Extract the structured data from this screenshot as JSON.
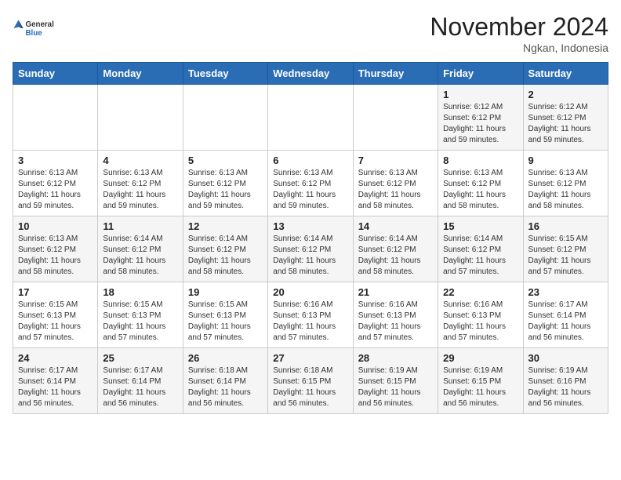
{
  "header": {
    "logo_general": "General",
    "logo_blue": "Blue",
    "month_title": "November 2024",
    "subtitle": "Ngkan, Indonesia"
  },
  "days_of_week": [
    "Sunday",
    "Monday",
    "Tuesday",
    "Wednesday",
    "Thursday",
    "Friday",
    "Saturday"
  ],
  "weeks": [
    [
      {
        "day": "",
        "info": ""
      },
      {
        "day": "",
        "info": ""
      },
      {
        "day": "",
        "info": ""
      },
      {
        "day": "",
        "info": ""
      },
      {
        "day": "",
        "info": ""
      },
      {
        "day": "1",
        "info": "Sunrise: 6:12 AM\nSunset: 6:12 PM\nDaylight: 11 hours and 59 minutes."
      },
      {
        "day": "2",
        "info": "Sunrise: 6:12 AM\nSunset: 6:12 PM\nDaylight: 11 hours and 59 minutes."
      }
    ],
    [
      {
        "day": "3",
        "info": "Sunrise: 6:13 AM\nSunset: 6:12 PM\nDaylight: 11 hours and 59 minutes."
      },
      {
        "day": "4",
        "info": "Sunrise: 6:13 AM\nSunset: 6:12 PM\nDaylight: 11 hours and 59 minutes."
      },
      {
        "day": "5",
        "info": "Sunrise: 6:13 AM\nSunset: 6:12 PM\nDaylight: 11 hours and 59 minutes."
      },
      {
        "day": "6",
        "info": "Sunrise: 6:13 AM\nSunset: 6:12 PM\nDaylight: 11 hours and 59 minutes."
      },
      {
        "day": "7",
        "info": "Sunrise: 6:13 AM\nSunset: 6:12 PM\nDaylight: 11 hours and 58 minutes."
      },
      {
        "day": "8",
        "info": "Sunrise: 6:13 AM\nSunset: 6:12 PM\nDaylight: 11 hours and 58 minutes."
      },
      {
        "day": "9",
        "info": "Sunrise: 6:13 AM\nSunset: 6:12 PM\nDaylight: 11 hours and 58 minutes."
      }
    ],
    [
      {
        "day": "10",
        "info": "Sunrise: 6:13 AM\nSunset: 6:12 PM\nDaylight: 11 hours and 58 minutes."
      },
      {
        "day": "11",
        "info": "Sunrise: 6:14 AM\nSunset: 6:12 PM\nDaylight: 11 hours and 58 minutes."
      },
      {
        "day": "12",
        "info": "Sunrise: 6:14 AM\nSunset: 6:12 PM\nDaylight: 11 hours and 58 minutes."
      },
      {
        "day": "13",
        "info": "Sunrise: 6:14 AM\nSunset: 6:12 PM\nDaylight: 11 hours and 58 minutes."
      },
      {
        "day": "14",
        "info": "Sunrise: 6:14 AM\nSunset: 6:12 PM\nDaylight: 11 hours and 58 minutes."
      },
      {
        "day": "15",
        "info": "Sunrise: 6:14 AM\nSunset: 6:12 PM\nDaylight: 11 hours and 57 minutes."
      },
      {
        "day": "16",
        "info": "Sunrise: 6:15 AM\nSunset: 6:12 PM\nDaylight: 11 hours and 57 minutes."
      }
    ],
    [
      {
        "day": "17",
        "info": "Sunrise: 6:15 AM\nSunset: 6:13 PM\nDaylight: 11 hours and 57 minutes."
      },
      {
        "day": "18",
        "info": "Sunrise: 6:15 AM\nSunset: 6:13 PM\nDaylight: 11 hours and 57 minutes."
      },
      {
        "day": "19",
        "info": "Sunrise: 6:15 AM\nSunset: 6:13 PM\nDaylight: 11 hours and 57 minutes."
      },
      {
        "day": "20",
        "info": "Sunrise: 6:16 AM\nSunset: 6:13 PM\nDaylight: 11 hours and 57 minutes."
      },
      {
        "day": "21",
        "info": "Sunrise: 6:16 AM\nSunset: 6:13 PM\nDaylight: 11 hours and 57 minutes."
      },
      {
        "day": "22",
        "info": "Sunrise: 6:16 AM\nSunset: 6:13 PM\nDaylight: 11 hours and 57 minutes."
      },
      {
        "day": "23",
        "info": "Sunrise: 6:17 AM\nSunset: 6:14 PM\nDaylight: 11 hours and 56 minutes."
      }
    ],
    [
      {
        "day": "24",
        "info": "Sunrise: 6:17 AM\nSunset: 6:14 PM\nDaylight: 11 hours and 56 minutes."
      },
      {
        "day": "25",
        "info": "Sunrise: 6:17 AM\nSunset: 6:14 PM\nDaylight: 11 hours and 56 minutes."
      },
      {
        "day": "26",
        "info": "Sunrise: 6:18 AM\nSunset: 6:14 PM\nDaylight: 11 hours and 56 minutes."
      },
      {
        "day": "27",
        "info": "Sunrise: 6:18 AM\nSunset: 6:15 PM\nDaylight: 11 hours and 56 minutes."
      },
      {
        "day": "28",
        "info": "Sunrise: 6:19 AM\nSunset: 6:15 PM\nDaylight: 11 hours and 56 minutes."
      },
      {
        "day": "29",
        "info": "Sunrise: 6:19 AM\nSunset: 6:15 PM\nDaylight: 11 hours and 56 minutes."
      },
      {
        "day": "30",
        "info": "Sunrise: 6:19 AM\nSunset: 6:16 PM\nDaylight: 11 hours and 56 minutes."
      }
    ]
  ]
}
